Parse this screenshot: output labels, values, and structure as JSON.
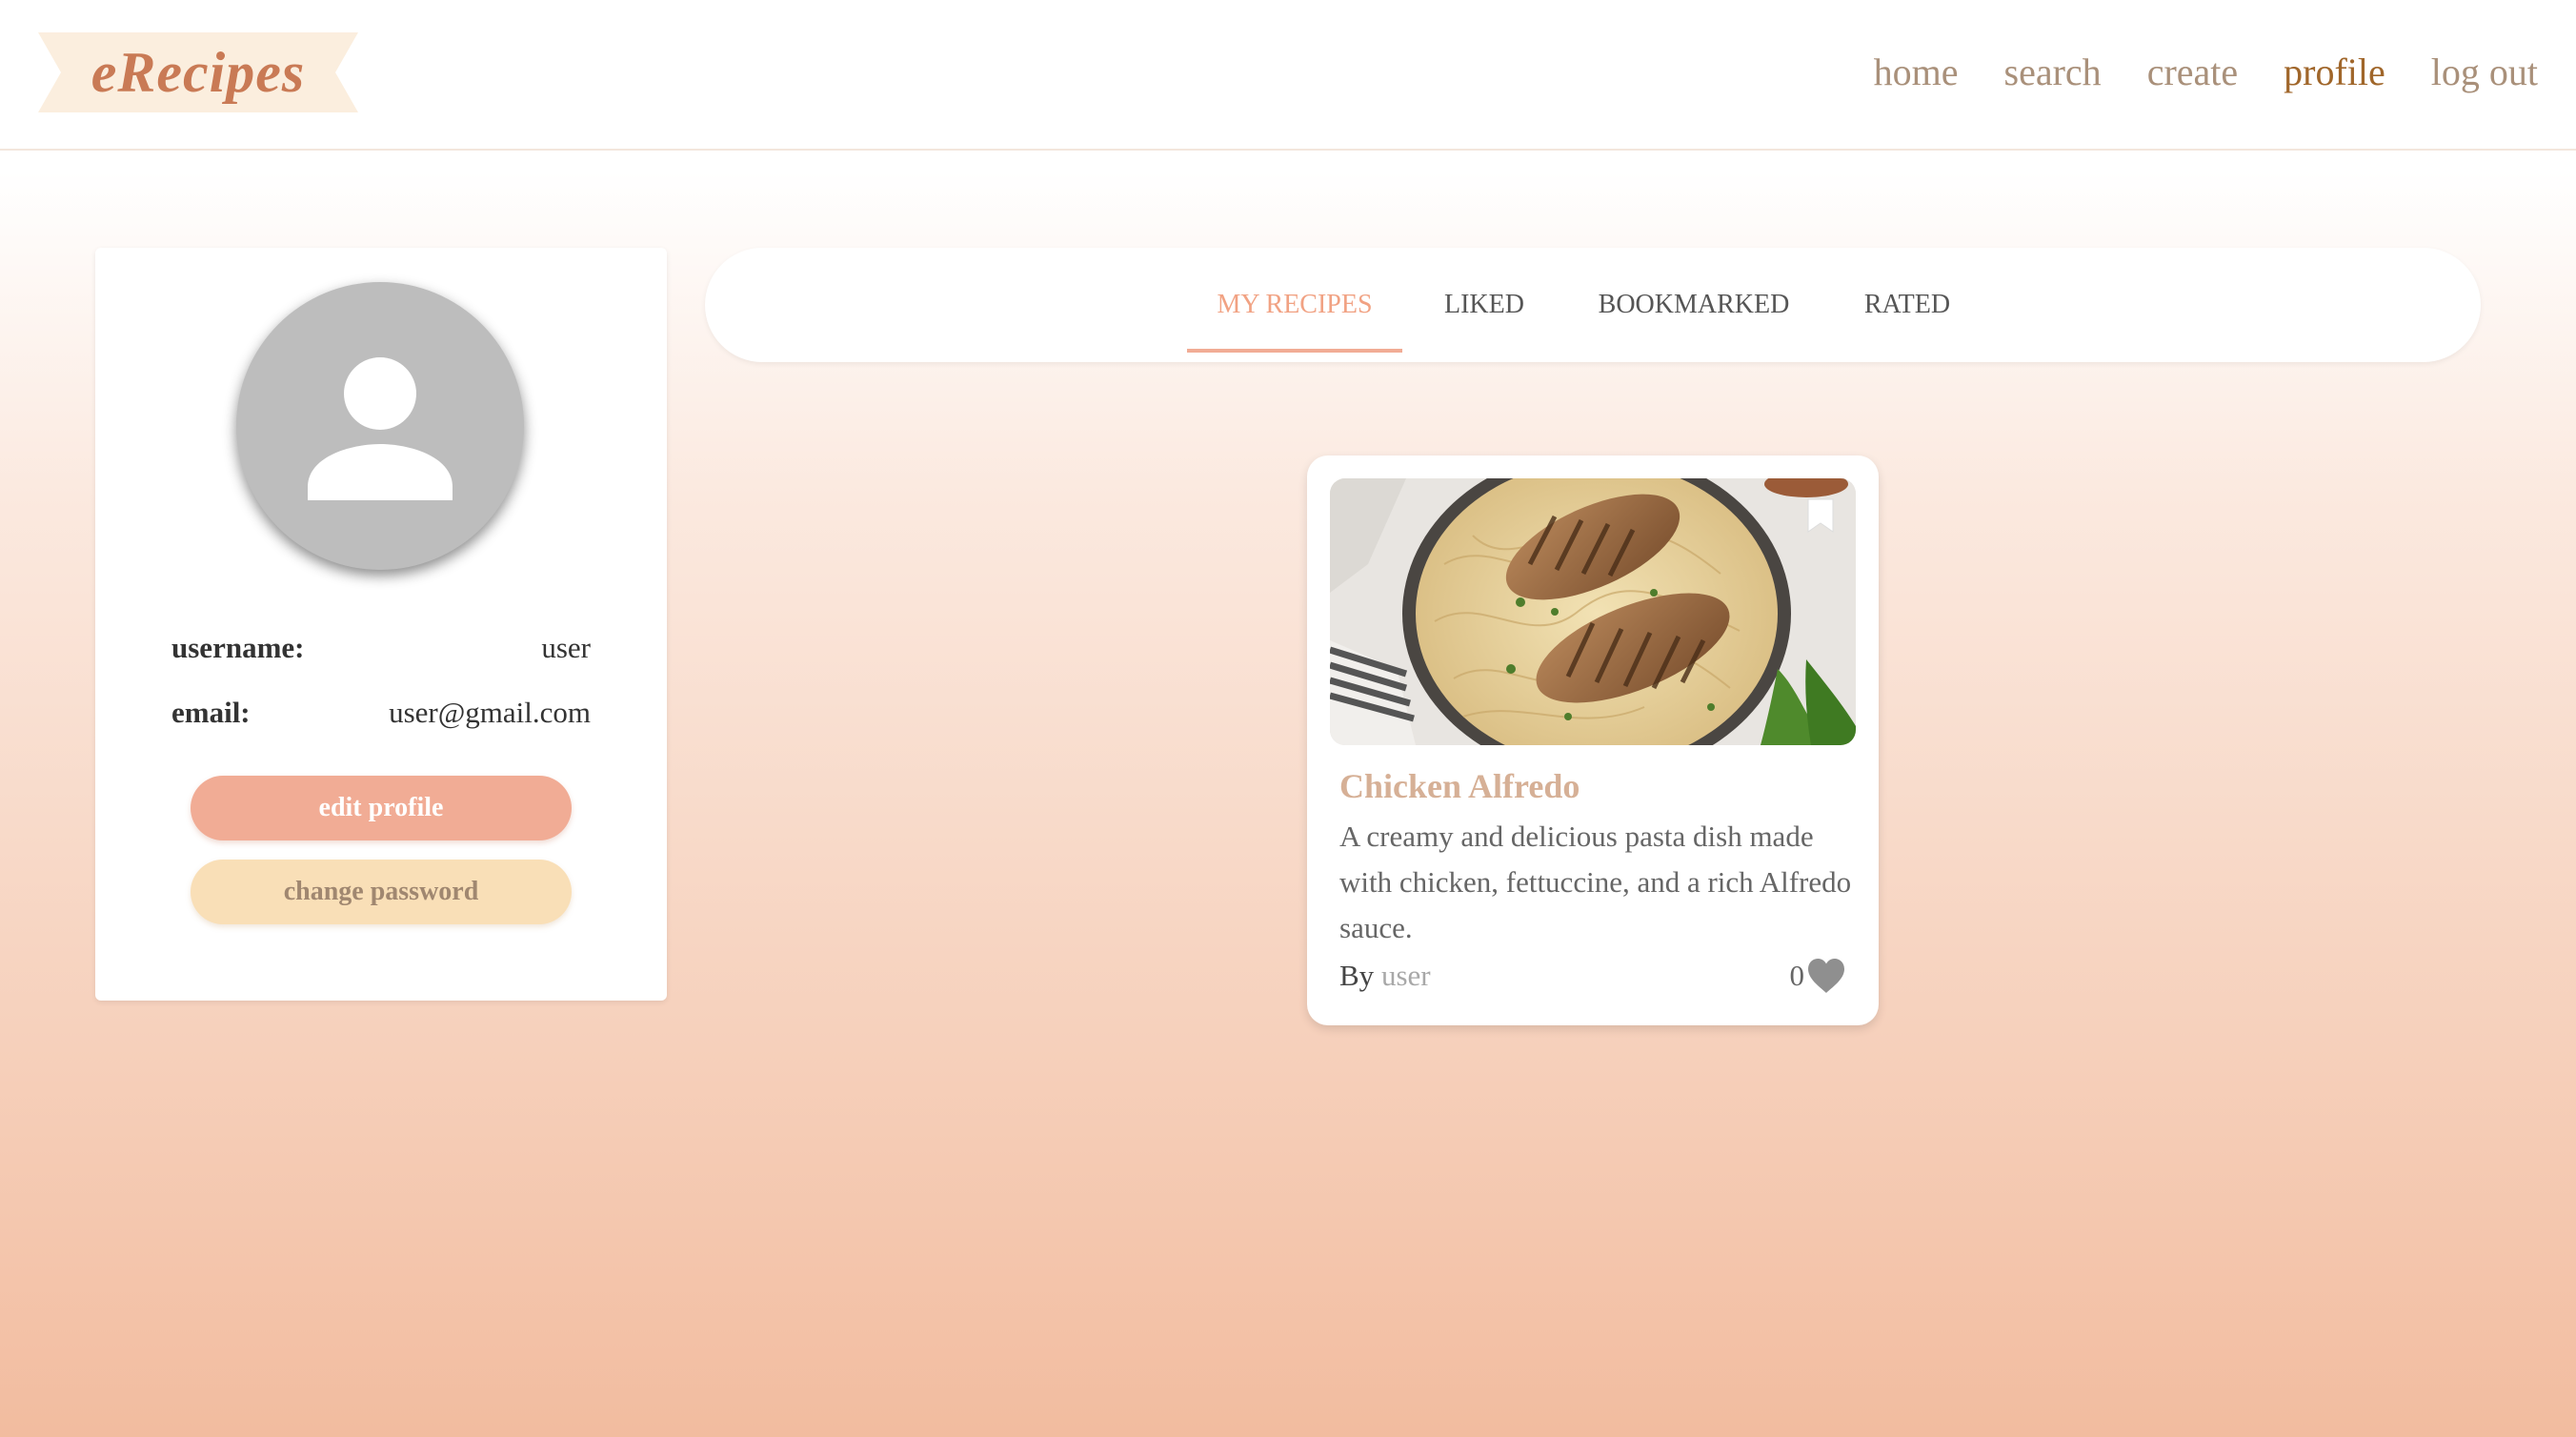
{
  "header": {
    "logo": "eRecipes",
    "nav": [
      {
        "label": "home"
      },
      {
        "label": "search"
      },
      {
        "label": "create"
      },
      {
        "label": "profile"
      },
      {
        "label": "log out"
      }
    ],
    "active_nav": "profile"
  },
  "profile": {
    "username_label": "username:",
    "username_value": "user",
    "email_label": "email:",
    "email_value": "user@gmail.com",
    "edit_button": "edit profile",
    "password_button": "change password"
  },
  "tabs": [
    {
      "label": "MY RECIPES"
    },
    {
      "label": "LIKED"
    },
    {
      "label": "BOOKMARKED"
    },
    {
      "label": "RATED"
    }
  ],
  "active_tab": "MY RECIPES",
  "recipe": {
    "title": "Chicken Alfredo",
    "description": "A creamy and delicious pasta dish made with chicken, fettuccine, and a rich Alfredo sauce.",
    "by_label": "By",
    "author": "user",
    "likes": "0"
  },
  "colors": {
    "accent": "#f1ac95",
    "logo": "#c97a55",
    "active_nav": "#a0662a",
    "nav": "#a9907a"
  },
  "icons": {
    "avatar": "person-icon",
    "bookmark": "bookmark-icon",
    "like": "heart-icon"
  }
}
